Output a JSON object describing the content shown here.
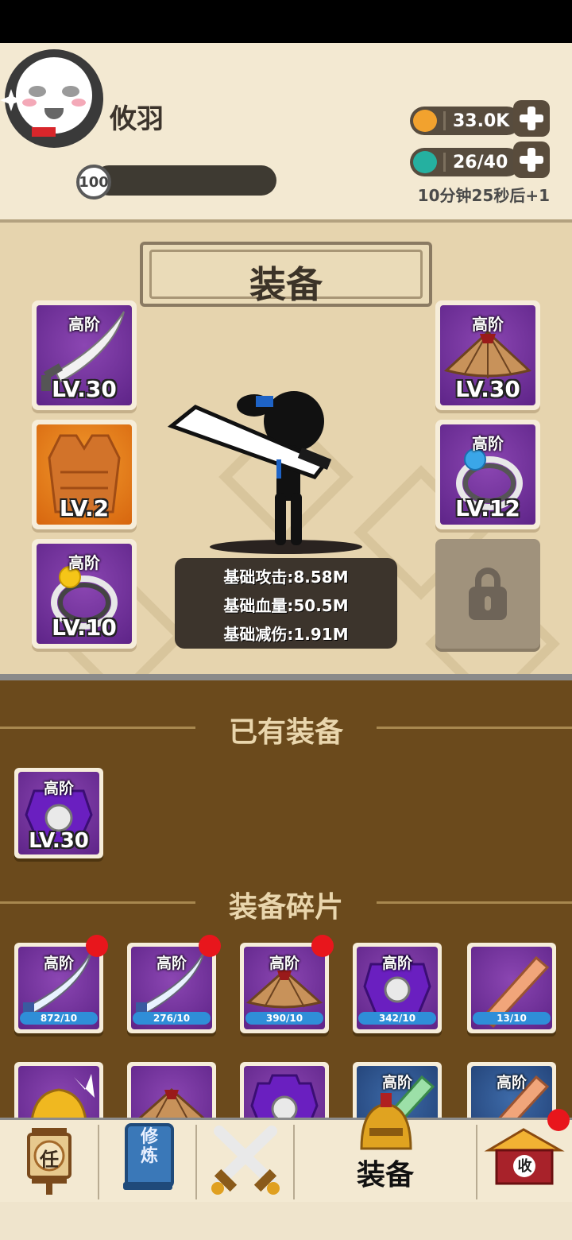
{
  "player": {
    "name": "攸羽",
    "level": "100"
  },
  "resources": {
    "gold": "33.0K",
    "energy": "26/40",
    "timer": "10分钟25秒后+1"
  },
  "panel": {
    "title": "装备"
  },
  "equipped": [
    {
      "slot": "weapon",
      "tier": "高阶",
      "level": "LV.30",
      "bg": "purple",
      "icon": "sword-icon"
    },
    {
      "slot": "armor",
      "tier": "",
      "level": "LV.2",
      "bg": "orange",
      "icon": "vest-icon"
    },
    {
      "slot": "ring-left",
      "tier": "高阶",
      "level": "LV.10",
      "bg": "purple",
      "icon": "gold-ring-icon"
    },
    {
      "slot": "hat",
      "tier": "高阶",
      "level": "LV.30",
      "bg": "purple",
      "icon": "straw-hat-icon"
    },
    {
      "slot": "ring-right",
      "tier": "高阶",
      "level": "LV.12",
      "bg": "purple",
      "icon": "blue-ring-icon"
    },
    {
      "slot": "locked",
      "tier": "",
      "level": "",
      "bg": "locked",
      "icon": "lock-icon"
    }
  ],
  "stats": {
    "attack": "基础攻击:8.58M",
    "hp": "基础血量:50.5M",
    "reduction": "基础减伤:1.91M"
  },
  "owned": {
    "title": "已有装备",
    "items": [
      {
        "tier": "高阶",
        "level": "LV.30",
        "icon": "chest-armor-icon"
      }
    ]
  },
  "fragments": {
    "title": "装备碎片",
    "items": [
      {
        "tier": "高阶",
        "count": "872/10",
        "icon": "sword-icon",
        "bg": "purple",
        "alert": true
      },
      {
        "tier": "高阶",
        "count": "276/10",
        "icon": "sword-icon",
        "bg": "purple",
        "alert": true
      },
      {
        "tier": "高阶",
        "count": "390/10",
        "icon": "straw-hat-icon",
        "bg": "purple",
        "alert": true
      },
      {
        "tier": "高阶",
        "count": "342/10",
        "icon": "chest-armor-icon",
        "bg": "purple",
        "alert": false
      },
      {
        "tier": "",
        "count": "13/10",
        "icon": "broad-sword-icon",
        "bg": "purple",
        "alert": false
      },
      {
        "tier": "",
        "count": "",
        "icon": "gold-helmet-icon",
        "bg": "purple",
        "alert": false
      },
      {
        "tier": "",
        "count": "",
        "icon": "straw-hat-icon",
        "bg": "purple",
        "alert": false
      },
      {
        "tier": "",
        "count": "",
        "icon": "chest-armor-icon",
        "bg": "purple",
        "alert": false
      },
      {
        "tier": "高阶",
        "count": "",
        "icon": "green-sword-icon",
        "bg": "blue",
        "alert": false
      },
      {
        "tier": "高阶",
        "count": "",
        "icon": "broad-sword-icon",
        "bg": "blue",
        "alert": false
      }
    ]
  },
  "nav": {
    "task": "任",
    "cultivate": "修炼",
    "battle": "",
    "equip": "装备",
    "collect": "收"
  },
  "colors": {
    "panel": "#e6d4ae",
    "inventory": "#6b4a1c",
    "tier_purple": "#6b2e96",
    "alert_red": "#e8161c"
  }
}
